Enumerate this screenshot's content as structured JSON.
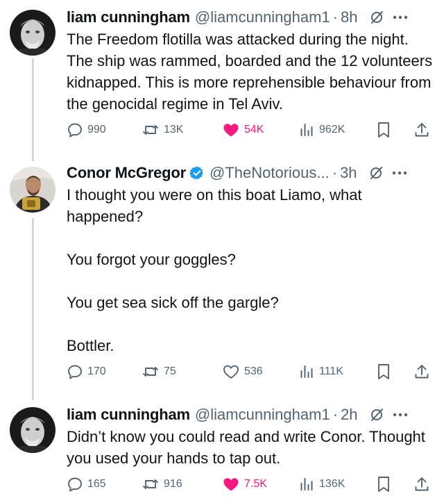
{
  "tweets": [
    {
      "author_name": "liam cunningham",
      "author_handle": "@liamcunningham1",
      "time": "8h",
      "text": "The Freedom flotilla was attacked during the night. The ship was rammed, boarded and the 12 volunteers kidnapped. This is more reprehensible behaviour from the genocidal regime in Tel Aviv.",
      "replies": "990",
      "reposts": "13K",
      "likes": "54K",
      "liked": true,
      "views": "962K"
    },
    {
      "author_name": "Conor McGregor",
      "author_handle": "@TheNotorious...",
      "time": "3h",
      "verified": true,
      "text": "I thought you were on this boat Liamo, what happened?\n\nYou forgot your goggles?\n\nYou get sea sick off the gargle?\n\nBottler.",
      "replies": "170",
      "reposts": "75",
      "likes": "536",
      "liked": false,
      "views": "111K"
    },
    {
      "author_name": "liam cunningham",
      "author_handle": "@liamcunningham1",
      "time": "2h",
      "text": "Didn’t know you could read and write Conor. Thought you used your hands to tap out.",
      "replies": "165",
      "reposts": "916",
      "likes": "7.5K",
      "liked": true,
      "views": "136K"
    }
  ],
  "separator": "·",
  "colors": {
    "text": "#0f1419",
    "secondary": "#536471",
    "like_active": "#f91880",
    "verified": "#1d9bf0",
    "thread_line": "#cfd9de"
  }
}
